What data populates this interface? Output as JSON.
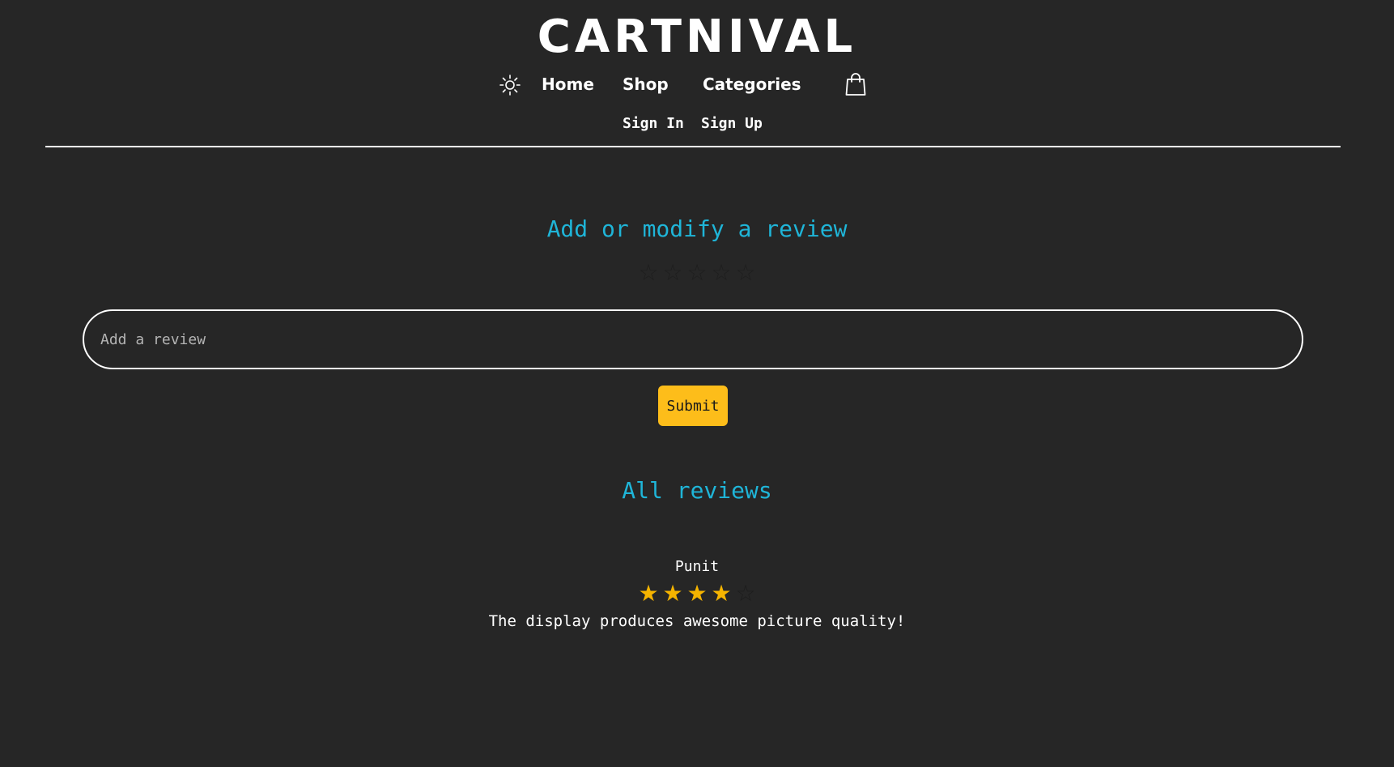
{
  "header": {
    "brand": "CARTNIVAL",
    "nav": {
      "home": "Home",
      "shop": "Shop",
      "categories": "Categories"
    },
    "icons": {
      "theme_toggle": "sun-icon",
      "cart": "shopping-bag-icon"
    },
    "auth": {
      "sign_in": "Sign In",
      "sign_up": "Sign Up"
    }
  },
  "review_form": {
    "title": "Add or modify a review",
    "rating": 0,
    "max_rating": 5,
    "input_placeholder": "Add a review",
    "input_value": "",
    "submit_label": "Submit"
  },
  "reviews_section": {
    "title": "All reviews",
    "reviews": [
      {
        "author": "Punit",
        "rating": 4,
        "max_rating": 5,
        "text": "The display produces awesome picture quality!"
      }
    ]
  },
  "colors": {
    "background": "#262626",
    "accent": "#1fb5d8",
    "button": "#fdbd1a",
    "star_filled": "#f5b400",
    "text": "#ffffff"
  }
}
